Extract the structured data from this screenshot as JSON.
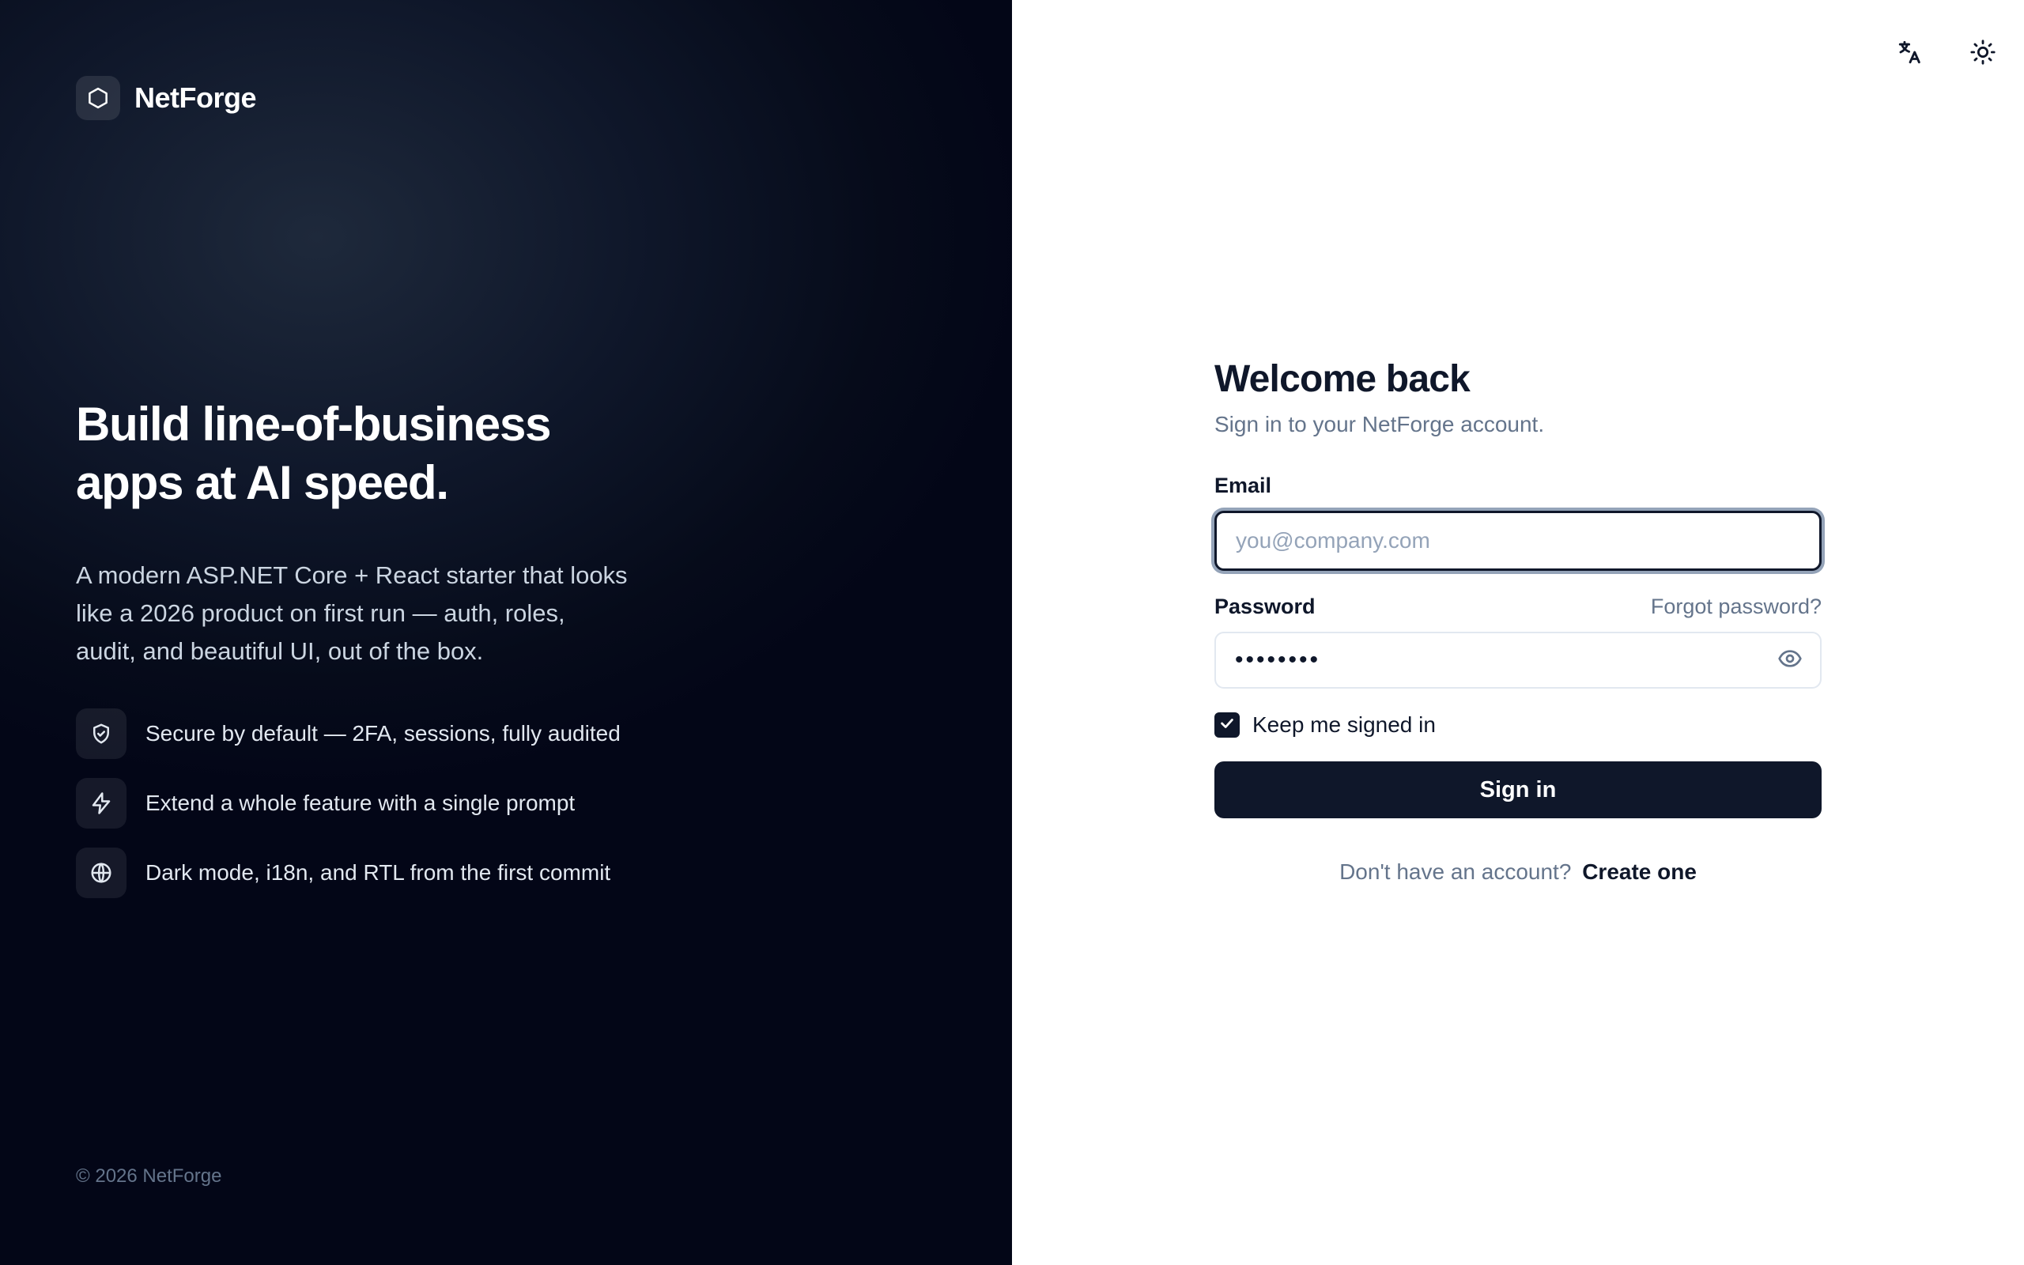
{
  "brand": {
    "name": "NetForge",
    "logo_icon": "hexagon-icon"
  },
  "hero": {
    "title": "Build line-of-business apps at AI speed.",
    "subtitle": "A modern ASP.NET Core + React starter that looks like a 2026 product on first run — auth, roles, audit, and beautiful UI, out of the box."
  },
  "features": [
    {
      "icon": "shield-check-icon",
      "text": "Secure by default — 2FA, sessions, fully audited"
    },
    {
      "icon": "lightning-icon",
      "text": "Extend a whole feature with a single prompt"
    },
    {
      "icon": "globe-icon",
      "text": "Dark mode, i18n, and RTL from the first commit"
    }
  ],
  "copyright": "© 2026 NetForge",
  "top_actions": {
    "language_icon": "translate-icon",
    "theme_icon": "sun-icon"
  },
  "form": {
    "title": "Welcome back",
    "subtitle": "Sign in to your NetForge account.",
    "email_label": "Email",
    "email_placeholder": "you@company.com",
    "email_value": "",
    "password_label": "Password",
    "forgot_label": "Forgot password?",
    "password_value": "••••••••",
    "remember_label": "Keep me signed in",
    "remember_checked": true,
    "signin_label": "Sign in",
    "no_account_text": "Don't have an account?",
    "create_label": "Create one"
  },
  "colors": {
    "primary": "#0f172a",
    "muted": "#64748b",
    "panel_dark": "#060b1a"
  }
}
